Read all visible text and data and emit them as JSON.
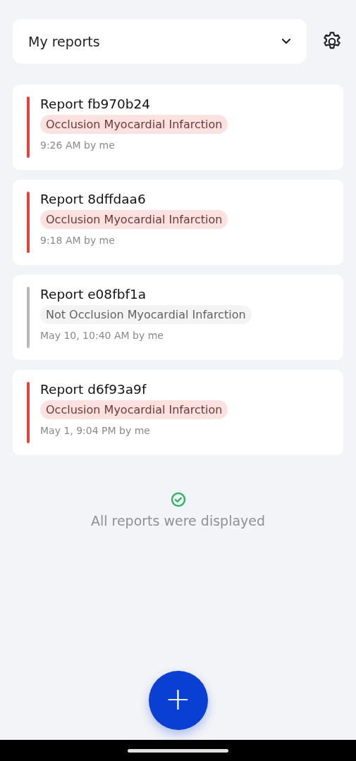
{
  "header": {
    "selector": {
      "value": "My reports"
    }
  },
  "reports": [
    {
      "title": "Report fb970b24",
      "tag": "Occlusion Myocardial Infarction",
      "time": "9:26 AM by me",
      "color": "#e8413c"
    },
    {
      "title": "Report 8dffdaa6",
      "tag": "Occlusion Myocardial Infarction",
      "time": "9:18 AM by me",
      "color": "#e8413c"
    },
    {
      "title": "Report e08fbf1a",
      "tag": "Not Occlusion Myocardial Infarction",
      "time": "May 10, 10:40 AM by me",
      "color": "#b8b9bd"
    },
    {
      "title": "Report d6f93a9f",
      "tag": "Occlusion Myocardial Infarction",
      "time": "May 1, 9:04 PM by me",
      "color": "#e8413c"
    }
  ],
  "footer": {
    "message": "All reports were displayed"
  },
  "fab": {
    "label": "+"
  }
}
